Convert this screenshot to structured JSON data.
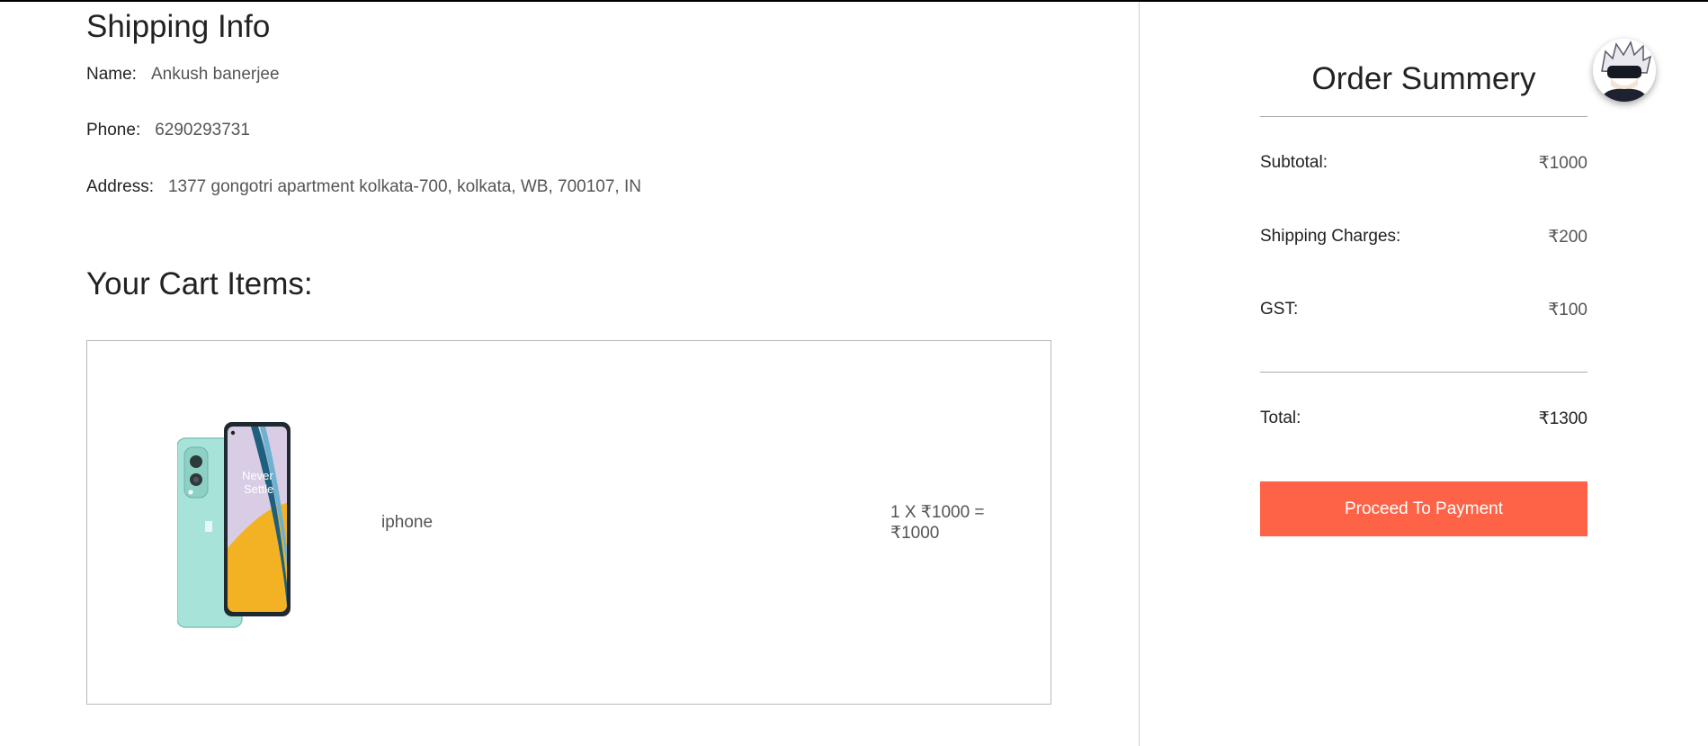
{
  "shipping": {
    "title": "Shipping Info",
    "name_label": "Name:",
    "name_value": "Ankush banerjee",
    "phone_label": "Phone:",
    "phone_value": "6290293731",
    "address_label": "Address:",
    "address_value": "1377 gongotri apartment kolkata-700, kolkata, WB, 700107, IN"
  },
  "cart": {
    "title": "Your Cart Items:",
    "items": [
      {
        "name": "iphone",
        "calc_line1": "1 X ₹1000 =",
        "calc_line2": "₹1000",
        "image_icon": "smartphone-product-image"
      }
    ]
  },
  "summary": {
    "title": "Order Summery",
    "subtotal_label": "Subtotal:",
    "subtotal_value": "₹1000",
    "shipping_label": "Shipping Charges:",
    "shipping_value": "₹200",
    "gst_label": "GST:",
    "gst_value": "₹100",
    "total_label": "Total:",
    "total_value": "₹1300",
    "button_label": "Proceed To Payment",
    "button_color": "#ff6347"
  },
  "user": {
    "avatar_icon": "user-avatar"
  }
}
